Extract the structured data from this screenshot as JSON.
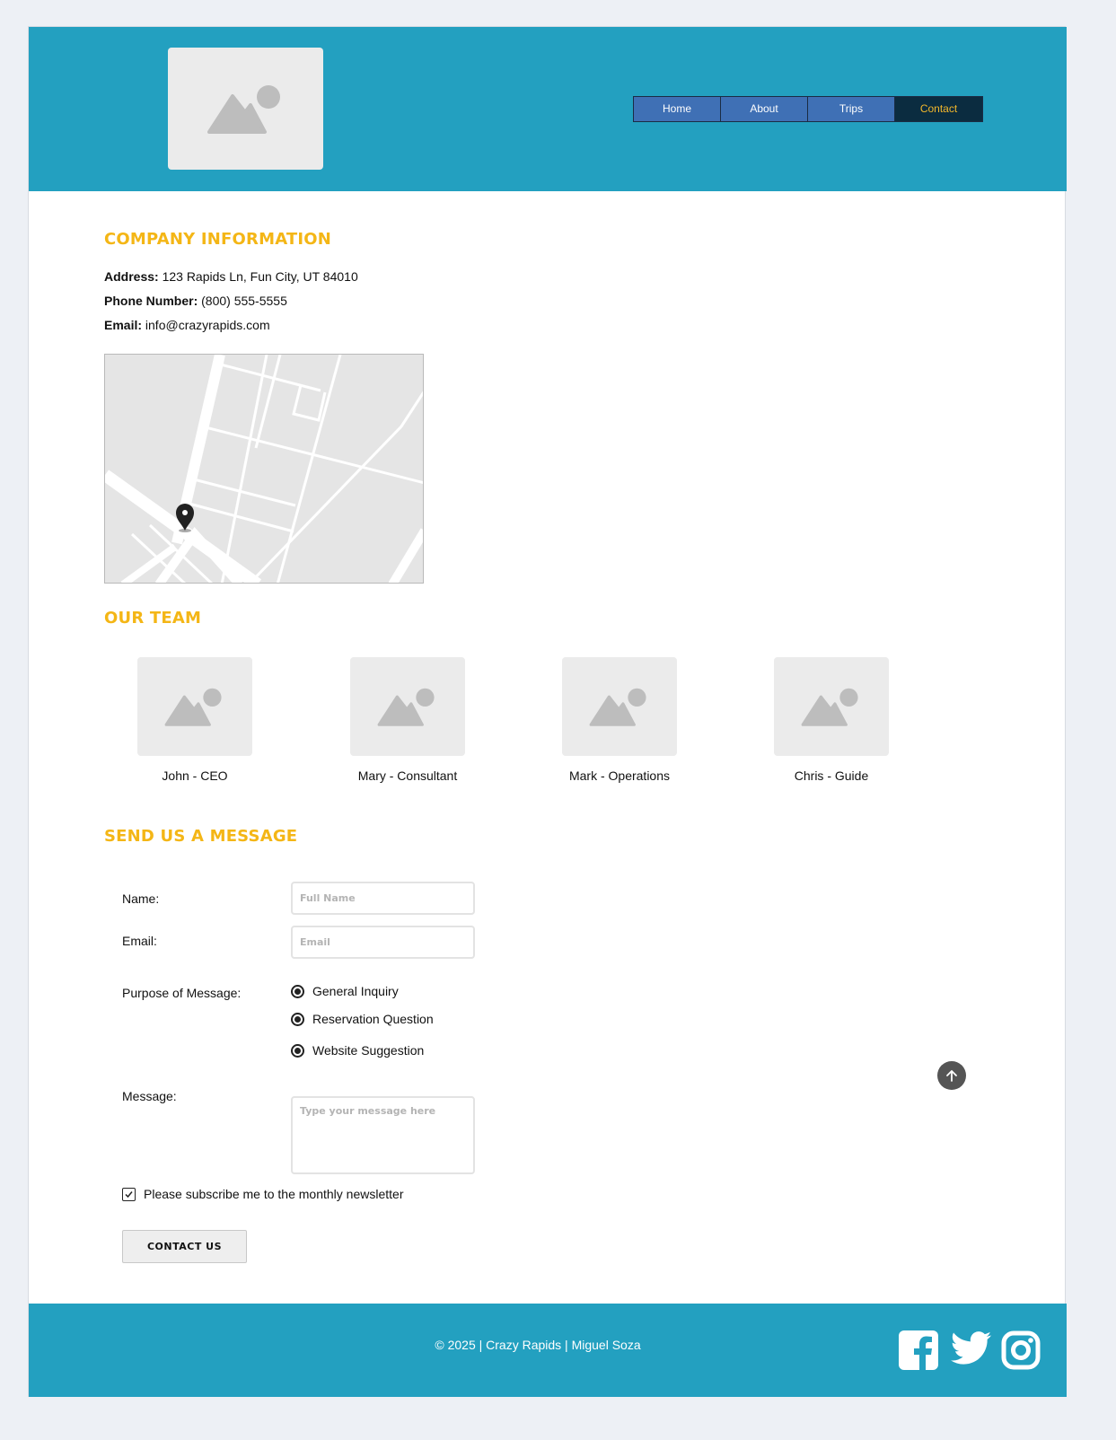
{
  "nav": {
    "home": "Home",
    "about": "About",
    "trips": "Trips",
    "contact": "Contact"
  },
  "company": {
    "heading": "COMPANY INFORMATION",
    "address_label": "Address:",
    "address": "123 Rapids Ln, Fun City, UT 84010",
    "phone_label": "Phone Number:",
    "phone": "(800) 555-5555",
    "email_label": "Email:",
    "email": "info@crazyrapids.com"
  },
  "team": {
    "heading": "OUR TEAM",
    "members": [
      {
        "caption": "John - CEO"
      },
      {
        "caption": "Mary - Consultant"
      },
      {
        "caption": "Mark - Operations"
      },
      {
        "caption": "Chris - Guide"
      }
    ]
  },
  "form": {
    "heading": "SEND US A MESSAGE",
    "name_label": "Name:",
    "name_placeholder": "Full Name",
    "email_label": "Email:",
    "email_placeholder": "Email",
    "purpose_label": "Purpose of Message:",
    "options": [
      "General Inquiry",
      "Reservation Question",
      "Website Suggestion"
    ],
    "message_label": "Message:",
    "message_placeholder": "Type your message here",
    "newsletter": "Please subscribe me to the monthly newsletter",
    "newsletter_checked": true,
    "submit": "CONTACT US"
  },
  "footer": {
    "copyright": "© 2025 | Crazy Rapids | Miguel Soza"
  },
  "icons": {
    "logo": "image-placeholder-icon",
    "map_pin": "map-pin-icon",
    "to_top": "arrow-up-icon",
    "social": [
      "facebook-icon",
      "twitter-icon",
      "instagram-icon"
    ]
  },
  "colors": {
    "header": "#23a0c0",
    "nav": "#3f70b5",
    "nav_active": "#0b2c40",
    "accent": "#f4b616"
  }
}
